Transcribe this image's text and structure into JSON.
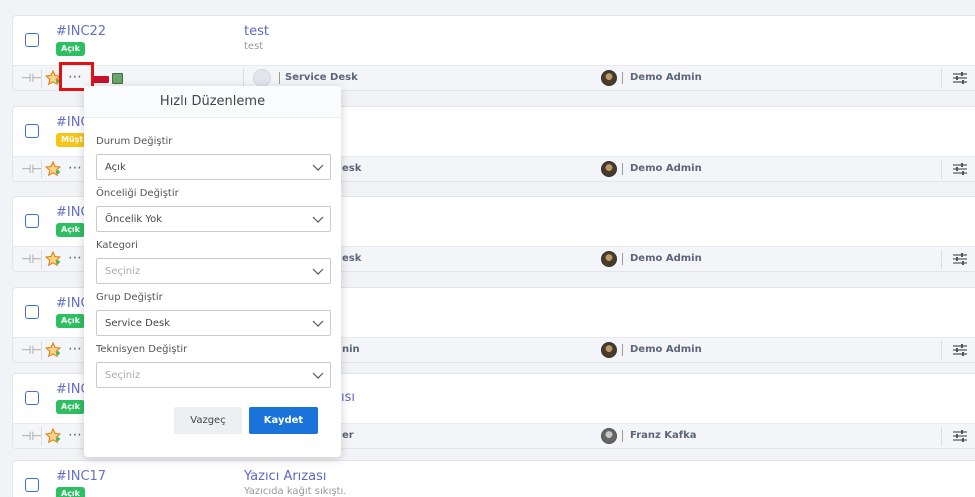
{
  "tickets": [
    {
      "id": "#INC22",
      "status": "Açık",
      "status_color": "#2fbf63",
      "subject": "test",
      "desc": "test",
      "group": "Service Desk",
      "tech": "Demo Admin",
      "show_tags": true
    },
    {
      "id": "#INC",
      "status": "Müşt",
      "status_color": "#f5c518",
      "subject": "",
      "desc": "",
      "group": "esk",
      "tech": "Demo Admin",
      "show_tags": false
    },
    {
      "id": "#INC",
      "status": "Açık",
      "status_color": "#2fbf63",
      "subject": "",
      "desc": "",
      "group": "esk",
      "tech": "Demo Admin",
      "show_tags": false
    },
    {
      "id": "#INC",
      "status": "Açık",
      "status_color": "#2fbf63",
      "subject": "",
      "desc": "",
      "group": "nin",
      "tech": "Demo Admin",
      "show_tags": false
    },
    {
      "id": "#INC",
      "status": "Açık",
      "status_color": "#2fbf63",
      "subject": "ısı",
      "desc": "",
      "group": "er",
      "tech": "Franz Kafka",
      "show_tags": false
    },
    {
      "id": "#INC17",
      "status": "Açık",
      "status_color": "#2fbf63",
      "subject": "Yazıcı Arızası",
      "desc": "Yazıcıda kağıt sıkıştı.",
      "group": "",
      "tech": "",
      "show_tags": false
    }
  ],
  "quick_edit": {
    "title": "Hızlı Düzenleme",
    "fields": [
      {
        "label": "Durum Değiştir",
        "value": "Açık",
        "placeholder": false
      },
      {
        "label": "Önceliği Değiştir",
        "value": "Öncelik Yok",
        "placeholder": false
      },
      {
        "label": "Kategori",
        "value": "Seçiniz",
        "placeholder": true
      },
      {
        "label": "Grup Değiştir",
        "value": "Service Desk",
        "placeholder": false
      },
      {
        "label": "Teknisyen Değiştir",
        "value": "Seçiniz",
        "placeholder": true
      }
    ],
    "cancel_label": "Vazgeç",
    "save_label": "Kaydet"
  },
  "colors": {
    "accent": "#1a73d9",
    "highlight": "#e01313",
    "tag_red": "#c8102e",
    "tag_green": "#6ba56b"
  }
}
